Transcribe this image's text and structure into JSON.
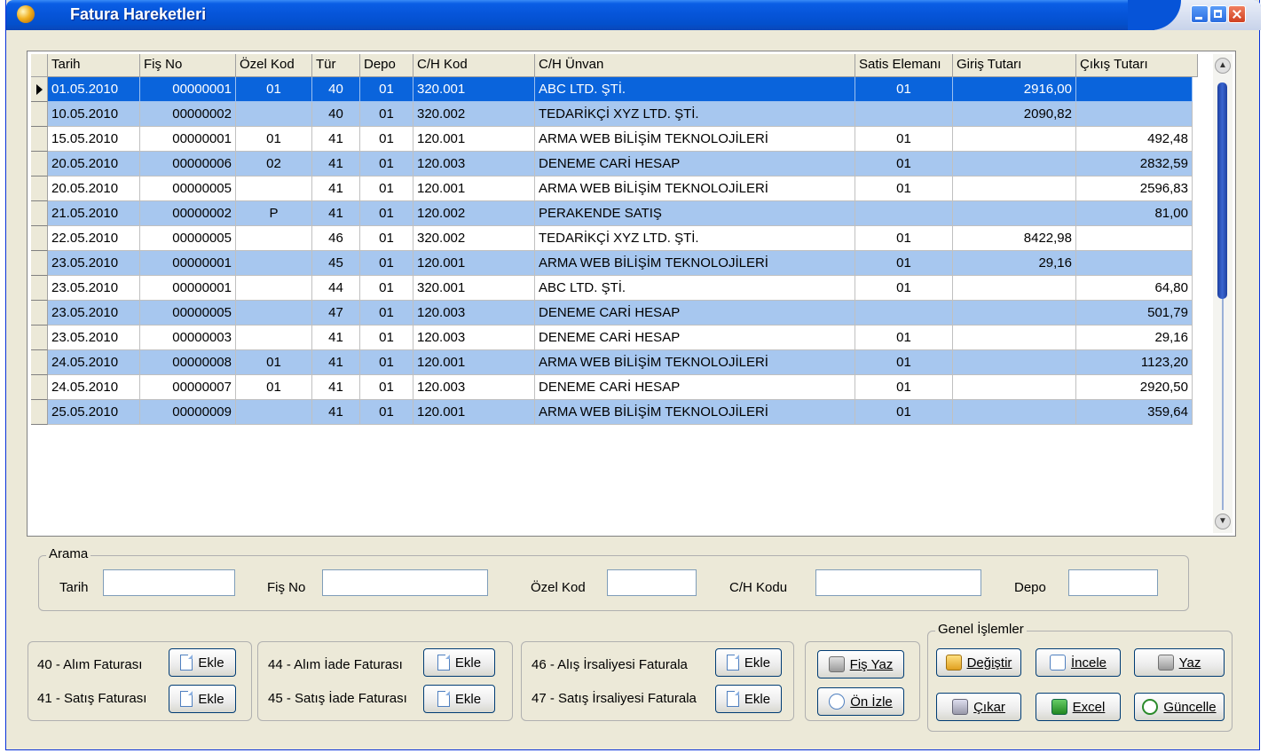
{
  "window": {
    "title": "Fatura Hareketleri"
  },
  "grid": {
    "columns": [
      "Tarih",
      "Fiş No",
      "Özel Kod",
      "Tür",
      "Depo",
      "C/H Kod",
      "C/H Ünvan",
      "Satis Elemanı",
      "Giriş Tutarı",
      "Çıkış Tutarı"
    ],
    "rows": [
      [
        "01.05.2010",
        "00000001",
        "01",
        "40",
        "01",
        "320.001",
        "ABC LTD. ŞTİ.",
        "01",
        "2916,00",
        ""
      ],
      [
        "10.05.2010",
        "00000002",
        "",
        "40",
        "01",
        "320.002",
        "TEDARİKÇİ XYZ LTD. ŞTİ.",
        "",
        "2090,82",
        ""
      ],
      [
        "15.05.2010",
        "00000001",
        "01",
        "41",
        "01",
        "120.001",
        "ARMA WEB BİLİŞİM TEKNOLOJİLERİ",
        "01",
        "",
        "492,48"
      ],
      [
        "20.05.2010",
        "00000006",
        "02",
        "41",
        "01",
        "120.003",
        "DENEME CARİ HESAP",
        "01",
        "",
        "2832,59"
      ],
      [
        "20.05.2010",
        "00000005",
        "",
        "41",
        "01",
        "120.001",
        "ARMA WEB BİLİŞİM TEKNOLOJİLERİ",
        "01",
        "",
        "2596,83"
      ],
      [
        "21.05.2010",
        "00000002",
        "P",
        "41",
        "01",
        "120.002",
        "PERAKENDE SATIŞ",
        "",
        "",
        "81,00"
      ],
      [
        "22.05.2010",
        "00000005",
        "",
        "46",
        "01",
        "320.002",
        "TEDARİKÇİ XYZ LTD. ŞTİ.",
        "01",
        "8422,98",
        ""
      ],
      [
        "23.05.2010",
        "00000001",
        "",
        "45",
        "01",
        "120.001",
        "ARMA WEB BİLİŞİM TEKNOLOJİLERİ",
        "01",
        "29,16",
        ""
      ],
      [
        "23.05.2010",
        "00000001",
        "",
        "44",
        "01",
        "320.001",
        "ABC LTD. ŞTİ.",
        "01",
        "",
        "64,80"
      ],
      [
        "23.05.2010",
        "00000005",
        "",
        "47",
        "01",
        "120.003",
        "DENEME CARİ HESAP",
        "",
        "",
        "501,79"
      ],
      [
        "23.05.2010",
        "00000003",
        "",
        "41",
        "01",
        "120.003",
        "DENEME CARİ HESAP",
        "01",
        "",
        "29,16"
      ],
      [
        "24.05.2010",
        "00000008",
        "01",
        "41",
        "01",
        "120.001",
        "ARMA WEB BİLİŞİM TEKNOLOJİLERİ",
        "01",
        "",
        "1123,20"
      ],
      [
        "24.05.2010",
        "00000007",
        "01",
        "41",
        "01",
        "120.003",
        "DENEME CARİ HESAP",
        "01",
        "",
        "2920,50"
      ],
      [
        "25.05.2010",
        "00000009",
        "",
        "41",
        "01",
        "120.001",
        "ARMA WEB BİLİŞİM TEKNOLOJİLERİ",
        "01",
        "",
        "359,64"
      ]
    ],
    "selected_row": 0
  },
  "search": {
    "legend": "Arama",
    "tarih_label": "Tarih",
    "fisno_label": "Fiş No",
    "ozelkod_label": "Özel Kod",
    "chkodu_label": "C/H Kodu",
    "depo_label": "Depo"
  },
  "invoice_groups": {
    "alim_label": "40 - Alım Faturası",
    "satis_label": "41 - Satış Faturası",
    "alim_iade_label": "44 - Alım İade Faturası",
    "satis_iade_label": "45 - Satış İade Faturası",
    "alis_irsaliye_label": "46 - Alış İrsaliyesi Faturala",
    "satis_irsaliye_label": "47 - Satış İrsaliyesi Faturala",
    "add_label": "Ekle"
  },
  "print": {
    "fis_yaz": "Fiş Yaz",
    "on_izle": "Ön İzle"
  },
  "general": {
    "legend": "Genel İşlemler",
    "degistir": "Değiştir",
    "incele": "İncele",
    "yaz": "Yaz",
    "cikar": "Çıkar",
    "excel": "Excel",
    "guncelle": "Güncelle"
  },
  "colors": {
    "title_bar": "#0654d8",
    "selected_row": "#0a64dc",
    "alt_row": "#a7c7ef",
    "window_face": "#ece9d8"
  }
}
